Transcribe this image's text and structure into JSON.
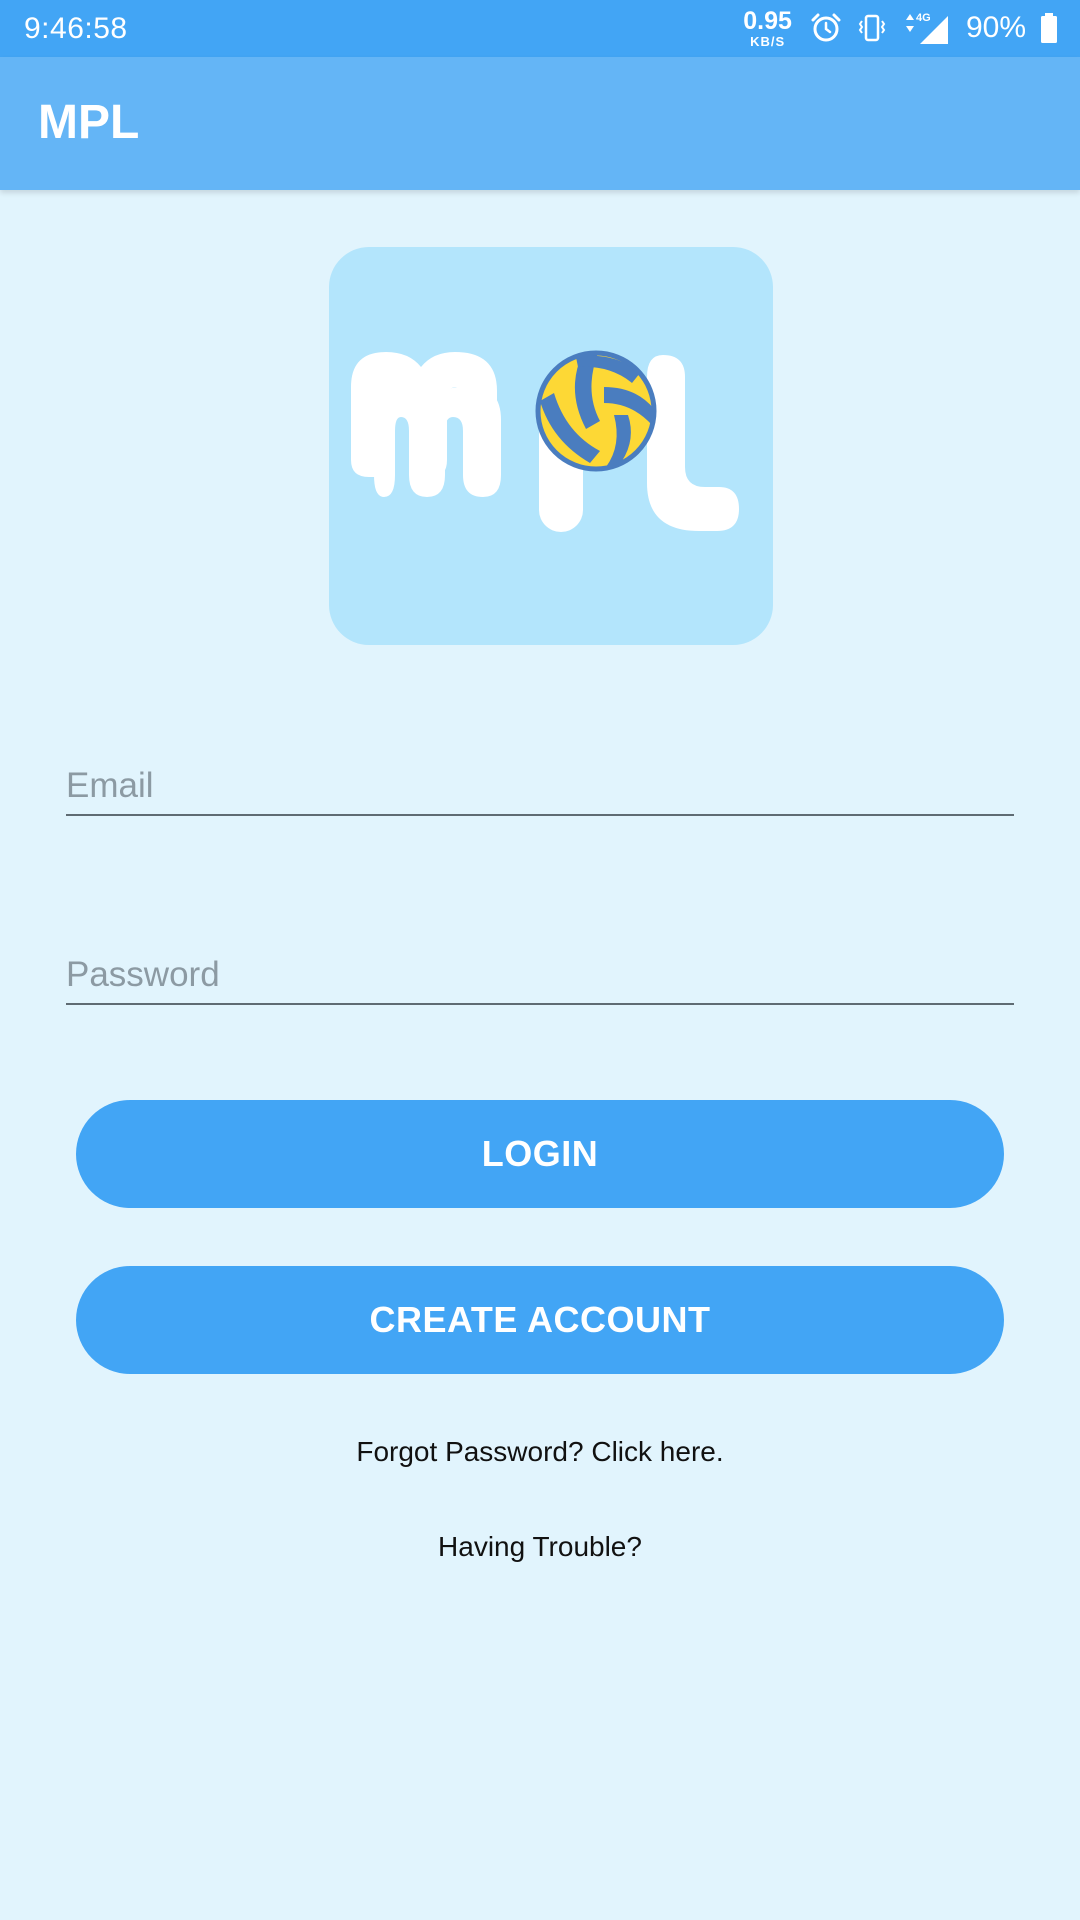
{
  "status_bar": {
    "time": "9:46:58",
    "net_speed_value": "0.95",
    "net_speed_unit": "KB/S",
    "network_type": "4G",
    "battery_percent": "90%"
  },
  "app_bar": {
    "title": "MPL"
  },
  "logo": {
    "label": "MPL",
    "icon": "volleyball-icon"
  },
  "form": {
    "email_placeholder": "Email",
    "password_placeholder": "Password",
    "login_label": "LOGIN",
    "create_account_label": "CREATE ACCOUNT",
    "forgot_password_text": "Forgot Password? Click here.",
    "trouble_text": "Having Trouble?"
  },
  "colors": {
    "status_bar": "#42A5F5",
    "app_bar": "#64B5F6",
    "background": "#E1F4FD",
    "logo_background": "#B3E5FC",
    "button": "#42A5F5",
    "ball_yellow": "#FDD835",
    "ball_blue": "#4A7DBF"
  }
}
